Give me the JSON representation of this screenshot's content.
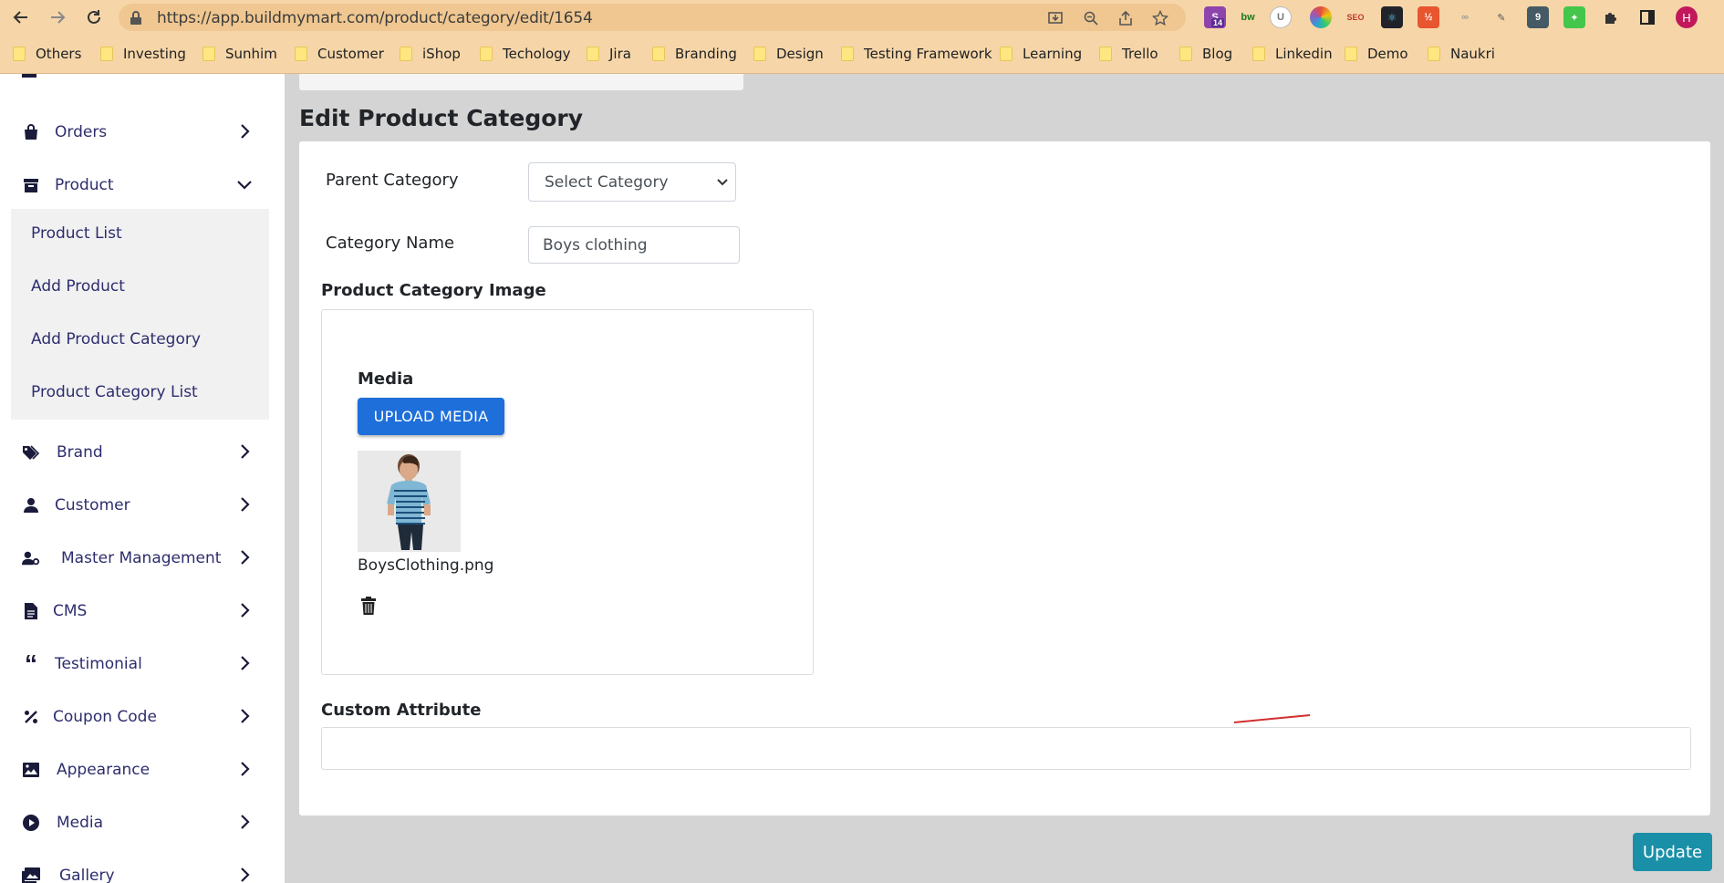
{
  "browser": {
    "url": "https://app.buildmymart.com/product/category/edit/1654",
    "profile_initial": "H",
    "extension_badge": "14",
    "bookmarks": [
      "Others",
      "Investing",
      "Sunhim",
      "Customer",
      "iShop",
      "Techology",
      "Jira",
      "Branding",
      "Design",
      "Testing Framework",
      "Learning",
      "Trello",
      "Blog",
      "Linkedin",
      "Demo",
      "Naukri"
    ]
  },
  "sidebar": {
    "items": [
      {
        "label": "Orders",
        "icon": "shopping-bag-icon"
      },
      {
        "label": "Product",
        "icon": "archive-box-icon"
      },
      {
        "label": "Brand",
        "icon": "tags-icon"
      },
      {
        "label": "Customer",
        "icon": "user-icon"
      },
      {
        "label": "Master Management",
        "icon": "user-gear-icon"
      },
      {
        "label": "CMS",
        "icon": "document-icon"
      },
      {
        "label": "Testimonial",
        "icon": "quote-icon"
      },
      {
        "label": "Coupon Code",
        "icon": "percent-icon"
      },
      {
        "label": "Appearance",
        "icon": "image-icon"
      },
      {
        "label": "Media",
        "icon": "play-circle-icon"
      },
      {
        "label": "Gallery",
        "icon": "images-icon"
      }
    ],
    "product_submenu": [
      "Product List",
      "Add Product",
      "Add Product Category",
      "Product Category List"
    ]
  },
  "main": {
    "title": "Edit Product Category",
    "parent_category_label": "Parent Category",
    "parent_category_value": "Select Category",
    "category_name_label": "Category Name",
    "category_name_value": "Boys clothing",
    "image_section_label": "Product Category Image",
    "media_label": "Media",
    "upload_button": "UPLOAD MEDIA",
    "file_name": "BoysClothing.png",
    "custom_attribute_label": "Custom Attribute",
    "update_button": "Update"
  },
  "colors": {
    "chrome": "#f6d6a8",
    "upload_button": "#1e6fd9",
    "update_button": "#1a8fa8",
    "sidebar_text": "#2d2d6e"
  }
}
